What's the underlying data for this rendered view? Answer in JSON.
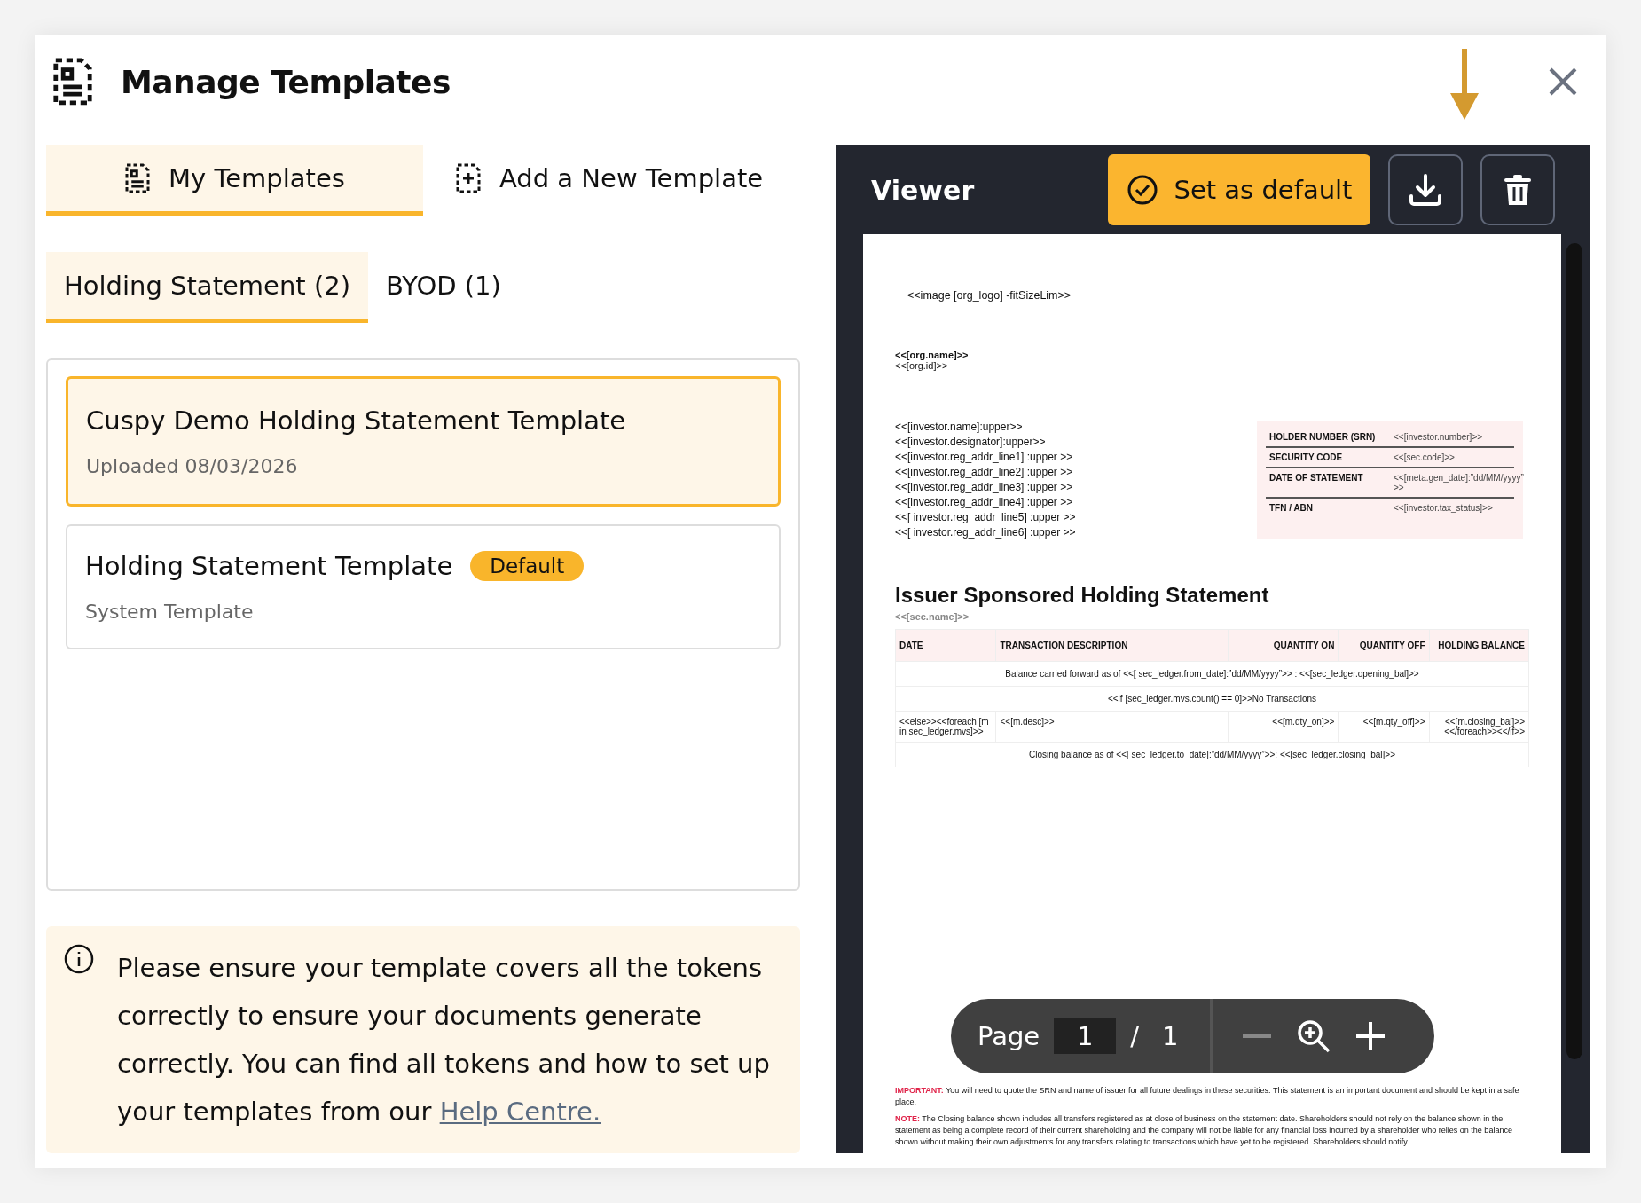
{
  "header": {
    "title": "Manage Templates"
  },
  "tabs": [
    {
      "label": "My Templates",
      "selected": true,
      "kind": "list"
    },
    {
      "label": "Add a New Template",
      "selected": false,
      "kind": "add"
    }
  ],
  "sub_tabs": [
    {
      "label": "Holding Statement (2)",
      "selected": true
    },
    {
      "label": "BYOD (1)",
      "selected": false
    }
  ],
  "templates": [
    {
      "name": "Cuspy Demo Holding Statement Template",
      "subtitle": "Uploaded 08/03/2026",
      "selected": true
    },
    {
      "name": "Holding Statement Template",
      "badge": "Default",
      "subtitle": "System Template",
      "selected": false
    }
  ],
  "info": {
    "text": "Please ensure your template covers all the tokens correctly to ensure your documents generate correctly. You can find all tokens and how to set up your templates from our ",
    "link": "Help Centre."
  },
  "viewer": {
    "title": "Viewer",
    "set_default": "Set as default"
  },
  "document": {
    "logo_token": "<<image [org_logo] -fitSizeLim>>",
    "org_name": "<<[org.name]>>",
    "org_id": "<<[org.id]>>",
    "investor_lines": [
      "<<[investor.name]:upper>>",
      "<<[investor.designator]:upper>>",
      "<<[investor.reg_addr_line1] :upper >>",
      "<<[investor.reg_addr_line2] :upper >>",
      "<<[investor.reg_addr_line3] :upper >>",
      "<<[investor.reg_addr_line4] :upper >>",
      "<<[ investor.reg_addr_line5] :upper >>",
      "<<[ investor.reg_addr_line6] :upper >>"
    ],
    "details": [
      {
        "label": "HOLDER NUMBER (SRN)",
        "value": "<<[investor.number]>>"
      },
      {
        "label": "SECURITY CODE",
        "value": "<<[sec.code]>>"
      },
      {
        "label": "DATE OF STATEMENT",
        "value": "<<[meta.gen_date]:”dd/MM/yyyy” >>"
      },
      {
        "label": "TFN / ABN",
        "value": "<<[investor.tax_status]>>"
      }
    ],
    "heading": "Issuer Sponsored Holding Statement",
    "subheading": "<<[sec.name]>>",
    "columns": [
      "DATE",
      "TRANSACTION DESCRIPTION",
      "QUANTITY ON",
      "QUANTITY OFF",
      "HOLDING BALANCE"
    ],
    "rows": [
      {
        "kind": "merged",
        "text": "Balance carried forward as of <<[ sec_ledger.from_date]:”dd/MM/yyyy”>> : <<[sec_ledger.opening_bal]>>"
      },
      {
        "kind": "merged",
        "text": "<<if [sec_ledger.mvs.count() == 0]>>No Transactions"
      },
      {
        "kind": "cells",
        "cells": [
          "<<else>><<foreach [m in sec_ledger.mvs]>>",
          "<<[m.desc]>>",
          "<<[m.qty_on]>>",
          "<<[m.qty_off]>>",
          "<<[m.closing_bal]>><</foreach>><</if>>"
        ]
      },
      {
        "kind": "merged",
        "text": "Closing balance as of <<[ sec_ledger.to_date]:”dd/MM/yyyy”>>: <<[sec_ledger.closing_bal]>>"
      }
    ],
    "notes": [
      {
        "label": "IMPORTANT:",
        "text": "You will need to quote the SRN and name of issuer for all future dealings in these securities. This statement is an important document and should be kept in a safe place."
      },
      {
        "label": "NOTE:",
        "text": "The Closing balance shown includes all transfers registered as at close of business on the statement date. Shareholders should not rely on the balance shown in the statement as being a complete record of their current shareholding and the company will not be liable for any financial loss incurred by a shareholder who relies on the balance shown without making their own adjustments for any transfers relating to transactions which have yet to be registered. Shareholders should notify"
      }
    ]
  },
  "pager": {
    "label": "Page",
    "current": "1",
    "separator": "/",
    "total": "1"
  }
}
